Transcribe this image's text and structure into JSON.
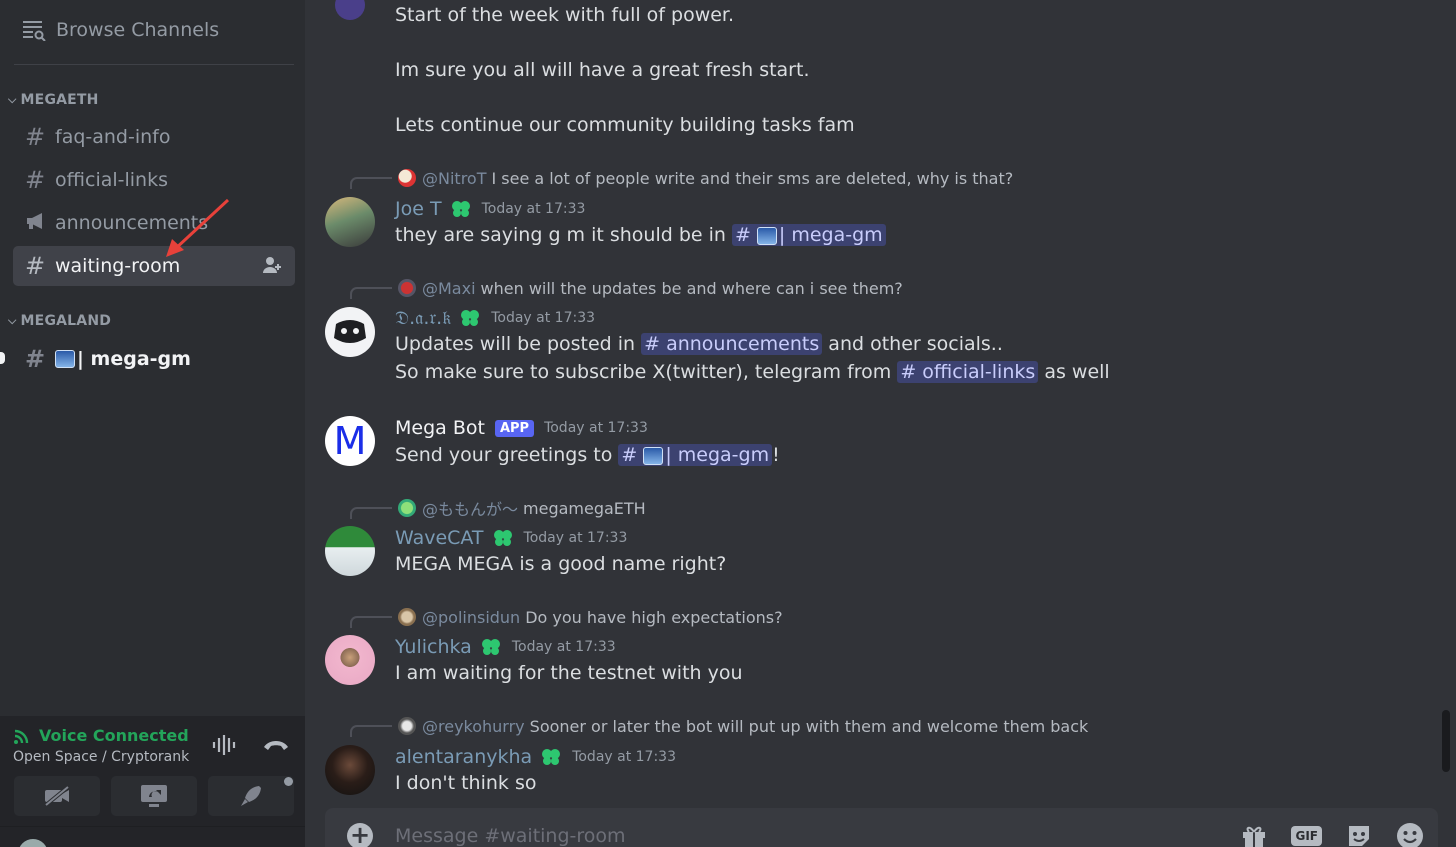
{
  "sidebar": {
    "browse_label": "Browse Channels",
    "categories": [
      {
        "name": "MEGAETH"
      },
      {
        "name": "MEGALAND"
      }
    ],
    "channels": [
      {
        "name": "faq-and-info"
      },
      {
        "name": "official-links"
      },
      {
        "name": "announcements"
      },
      {
        "name": "waiting-room"
      },
      {
        "name": "| mega-gm"
      }
    ]
  },
  "voice": {
    "status": "Voice Connected",
    "location": "Open Space / Cryptorank"
  },
  "messages": {
    "cont_lines": [
      "Start of the week with full of power.",
      "Im sure you all will have a great fresh start.",
      "Lets continue our community building tasks fam"
    ],
    "m1": {
      "reply_name": "@NitroT",
      "reply_text": "I see a lot of people write and their sms are deleted, why is that?",
      "author": "Joe T",
      "time": "Today at 17:33",
      "text": "they are saying g m it should be in",
      "mention": "| mega-gm"
    },
    "m2": {
      "reply_name": "@Maxi",
      "reply_text": "when will the updates be and where can i see them?",
      "author": "𝔇.𝔞.𝔯.𝔨",
      "time": "Today at 17:33",
      "line1_a": "Updates will be posted in",
      "mention1": "announcements",
      "line1_b": "and other socials..",
      "line2_a": "So make sure to subscribe X(twitter), telegram from",
      "mention2": "official-links",
      "line2_b": "as well"
    },
    "m3": {
      "author": "Mega Bot",
      "badge": "APP",
      "time": "Today at 17:33",
      "text": "Send your greetings to",
      "mention": "| mega-gm",
      "tail": "!"
    },
    "m4": {
      "reply_name": "@ももんが〜",
      "reply_text": "megamegaETH",
      "author": "WaveCAT",
      "time": "Today at 17:33",
      "text": "MEGA MEGA is a good name right?"
    },
    "m5": {
      "reply_name": "@polinsidun",
      "reply_text": "Do you have high expectations?",
      "author": "Yulichka",
      "time": "Today at 17:33",
      "text": "I am waiting for the testnet with you"
    },
    "m6": {
      "reply_name": "@reykohurry",
      "reply_text": "Sooner or later the bot will put up with them and welcome them back",
      "author": "alentaranykha",
      "time": "Today at 17:33",
      "text": "I don't think so"
    }
  },
  "composer": {
    "placeholder": "Message #waiting-room",
    "gif_label": "GIF"
  },
  "colors": {
    "accent": "#5865f2",
    "online_green": "#23a55a",
    "mention_bg": "#3c4270",
    "clover": "#2dc770"
  }
}
